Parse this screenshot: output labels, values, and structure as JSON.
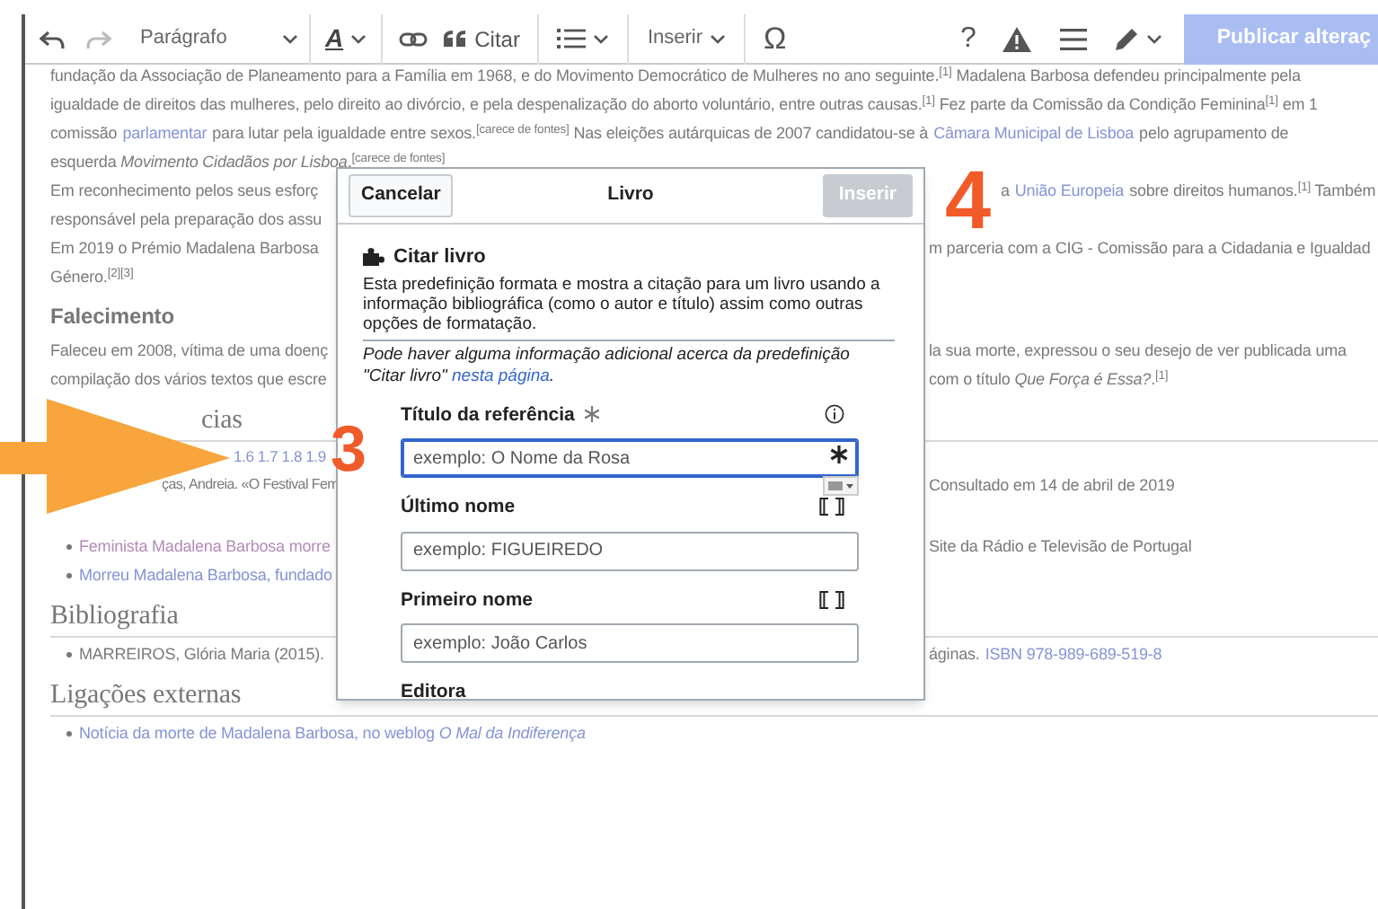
{
  "toolbar": {
    "format_menu": "Parágrafo",
    "style_letter": "A",
    "cite_button": "Citar",
    "insert_menu": "Inserir",
    "special_character": "Ω",
    "help": "?",
    "publish_button": {
      "label": "Publicar alteraç",
      "disabled": true
    }
  },
  "article": [
    {
      "kind": "paragraph",
      "lines": [
        {
          "kind": "text",
          "left": [
            {
              "kind": "text",
              "text": "fundação da Associação de Planeamento para a Família em 1968, e do Movimento Democrático de Mulheres no ano seguinte.$^{[1]}$ Madalena Barbosa defendeu principalmente pela"
            }
          ]
        },
        {
          "kind": "text",
          "left": [
            {
              "kind": "text",
              "text": "igualdade de direitos das mulheres, pelo direito ao divórcio, e pela despenalização do aborto voluntário, entre outras causas.$^{[1]}$ Fez parte da Comissão da Condição Feminina$^{[1]}$ em 1"
            }
          ]
        },
        {
          "kind": "text",
          "left": [
            {
              "kind": "text",
              "text": "comissão"
            },
            {
              "kind": "link",
              "text": "parlamentar"
            },
            {
              "kind": "text",
              "text": "para lutar pela igualdade entre sexos.$^{[carece de fontes]}$ Nas eleições autárquicas de 2007 candidatou-se à"
            },
            {
              "kind": "link",
              "text": "Câmara Municipal de Lisboa"
            },
            {
              "kind": "text",
              "text": "pelo agrupamento de"
            }
          ]
        },
        {
          "kind": "text",
          "left": [
            {
              "kind": "text",
              "text": "esquerda *Movimento Cidadãos por Lisboa*.$^{[carece de fontes]}$"
            }
          ]
        }
      ]
    },
    {
      "kind": "paragraph",
      "lines": [
        {
          "kind": "text",
          "left": [
            {
              "kind": "text",
              "text": "Em reconhecimento pelos seus esforç"
            }
          ],
          "right_offset": true,
          "right": [
            {
              "kind": "text",
              "text": "a"
            },
            {
              "kind": "link",
              "text": "União Europeia"
            },
            {
              "kind": "text",
              "text": "sobre direitos humanos.$^{[1]}$ Também"
            }
          ]
        },
        {
          "kind": "text",
          "left": [
            {
              "kind": "text",
              "text": "responsável pela preparação dos assu"
            }
          ]
        }
      ]
    },
    {
      "kind": "paragraph",
      "lines": [
        {
          "kind": "text",
          "left": [
            {
              "kind": "text",
              "text": "Em 2019 o Prémio Madalena Barbosa"
            }
          ],
          "right_offset": false,
          "right": [
            {
              "kind": "text",
              "text": "m parceria com a CIG - Comissão para a Cidadania e Igualdad"
            }
          ]
        },
        {
          "kind": "text",
          "left": [
            {
              "kind": "text",
              "text": "Género.$^{[2][3]}$"
            }
          ]
        }
      ]
    },
    {
      "kind": "heading",
      "text": "Falecimento"
    },
    {
      "kind": "paragraph",
      "lines": [
        {
          "kind": "text",
          "left": [
            {
              "kind": "text",
              "text": "Faleceu em 2008, vítima de uma doenç"
            }
          ],
          "right_offset": false,
          "right": [
            {
              "kind": "text",
              "text": "la sua morte, expressou o seu desejo de ver publicada uma"
            }
          ]
        },
        {
          "kind": "text",
          "left": [
            {
              "kind": "text",
              "text": "compilação dos vários textos que escre"
            }
          ],
          "right_offset": false,
          "right": [
            {
              "kind": "text",
              "text": "com o título *Que Força é Essa?*.$^{[1]}$"
            }
          ]
        }
      ]
    },
    {
      "kind": "section_behind_arrow",
      "text": "cias"
    },
    {
      "kind": "paragraph",
      "lines": [
        {
          "kind": "backlinks",
          "left": [
            {
              "kind": "link",
              "text": "1.6 1.7 1.8 1.9"
            }
          ]
        },
        {
          "kind": "cut",
          "left": [
            {
              "kind": "text",
              "text": "ças, Andreia. «O Festival Fem"
            }
          ],
          "right_offset": false,
          "right": [
            {
              "kind": "text",
              "text": "Consultado em 14 de abril de 2019"
            }
          ]
        }
      ]
    },
    {
      "kind": "list",
      "lines": [
        {
          "kind": "bullet",
          "left": [
            {
              "kind": "visited_link",
              "text": "Feminista Madalena Barbosa morre"
            }
          ],
          "right_offset": false,
          "right": [
            {
              "kind": "text",
              "text": "Site da Rádio e Televisão de Portugal"
            }
          ]
        },
        {
          "kind": "bullet",
          "left": [
            {
              "kind": "link",
              "text": "Morreu Madalena Barbosa, fundado"
            }
          ]
        }
      ]
    },
    {
      "kind": "section",
      "text": "Bibliografia"
    },
    {
      "kind": "list",
      "lines": [
        {
          "kind": "bullet",
          "left": [
            {
              "kind": "text",
              "text": "MARREIROS, Glória Maria (2015)."
            }
          ],
          "right_offset": false,
          "right": [
            {
              "kind": "text",
              "text": "áginas."
            },
            {
              "kind": "link",
              "text": "ISBN 978-989-689-519-8"
            }
          ]
        }
      ]
    },
    {
      "kind": "section",
      "text": "Ligações externas"
    },
    {
      "kind": "list",
      "lines": [
        {
          "kind": "bullet",
          "left": [
            {
              "kind": "link",
              "text": "Notícia da morte de Madalena Barbosa, no weblog *O Mal da Indiferença*"
            }
          ]
        }
      ]
    }
  ],
  "dialog": {
    "cancel_button": "Cancelar",
    "title": "Livro",
    "insert_button": {
      "label": "Inserir",
      "disabled": true
    },
    "template_name": "Citar livro",
    "description": "Esta predefinição formata e mostra a citação para um livro usando a informação bibliográfica (como o autor e título) assim como outras opções de formatação.",
    "note": "Pode haver alguma informação adicional acerca da predefinição \"Citar livro\"",
    "note_link": "nesta página",
    "note_end": ".",
    "fields": [
      {
        "label": "Título da referência",
        "required": true,
        "kind": "info",
        "placeholder": "exemplo: O Nome da Rosa",
        "focused": true
      },
      {
        "label": "Último nome",
        "required": false,
        "kind": "page",
        "placeholder": "exemplo: FIGUEIREDO",
        "focused": false
      },
      {
        "label": "Primeiro nome",
        "required": false,
        "kind": "page",
        "placeholder": "exemplo: João Carlos",
        "focused": false
      },
      {
        "label": "Editora",
        "required": false,
        "kind": "none"
      }
    ]
  },
  "markers": [
    "3",
    "4"
  ]
}
